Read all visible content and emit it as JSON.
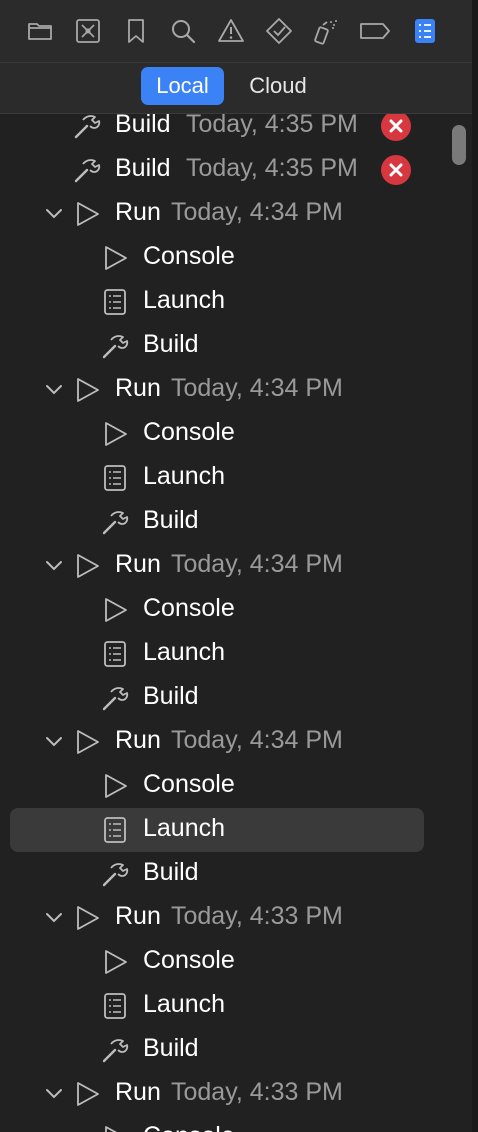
{
  "toolbar": {
    "icons": [
      "folder-icon",
      "source-control-icon",
      "bookmark-icon",
      "search-icon",
      "warning-icon",
      "test-diamond-icon",
      "debug-spray-icon",
      "breakpoint-tag-icon",
      "report-list-icon"
    ],
    "active_icon": "report-list-icon",
    "active_color": "#3b82f6"
  },
  "segment": {
    "local": "Local",
    "cloud": "Cloud",
    "selected": "Local"
  },
  "rows": [
    {
      "type": "Build",
      "label": "Build",
      "time": "Today, 4:35 PM",
      "error": true,
      "level": 0,
      "expandable": false
    },
    {
      "type": "Build",
      "label": "Build",
      "time": "Today, 4:35 PM",
      "error": true,
      "level": 0,
      "expandable": false
    },
    {
      "type": "Run",
      "label": "Run",
      "time": "Today, 4:34 PM",
      "level": 0,
      "expandable": true
    },
    {
      "type": "Console",
      "label": "Console",
      "level": 1
    },
    {
      "type": "Launch",
      "label": "Launch",
      "level": 1
    },
    {
      "type": "Build",
      "label": "Build",
      "level": 1
    },
    {
      "type": "Run",
      "label": "Run",
      "time": "Today, 4:34 PM",
      "level": 0,
      "expandable": true
    },
    {
      "type": "Console",
      "label": "Console",
      "level": 1
    },
    {
      "type": "Launch",
      "label": "Launch",
      "level": 1
    },
    {
      "type": "Build",
      "label": "Build",
      "level": 1
    },
    {
      "type": "Run",
      "label": "Run",
      "time": "Today, 4:34 PM",
      "level": 0,
      "expandable": true
    },
    {
      "type": "Console",
      "label": "Console",
      "level": 1
    },
    {
      "type": "Launch",
      "label": "Launch",
      "level": 1
    },
    {
      "type": "Build",
      "label": "Build",
      "level": 1
    },
    {
      "type": "Run",
      "label": "Run",
      "time": "Today, 4:34 PM",
      "level": 0,
      "expandable": true
    },
    {
      "type": "Console",
      "label": "Console",
      "level": 1
    },
    {
      "type": "Launch",
      "label": "Launch",
      "level": 1,
      "selected": true
    },
    {
      "type": "Build",
      "label": "Build",
      "level": 1
    },
    {
      "type": "Run",
      "label": "Run",
      "time": "Today, 4:33 PM",
      "level": 0,
      "expandable": true
    },
    {
      "type": "Console",
      "label": "Console",
      "level": 1
    },
    {
      "type": "Launch",
      "label": "Launch",
      "level": 1
    },
    {
      "type": "Build",
      "label": "Build",
      "level": 1
    },
    {
      "type": "Run",
      "label": "Run",
      "time": "Today, 4:33 PM",
      "level": 0,
      "expandable": true
    },
    {
      "type": "Console",
      "label": "Console",
      "level": 1
    }
  ],
  "colors": {
    "background": "#212121",
    "error": "#d7373f",
    "accent": "#3b82f6"
  }
}
